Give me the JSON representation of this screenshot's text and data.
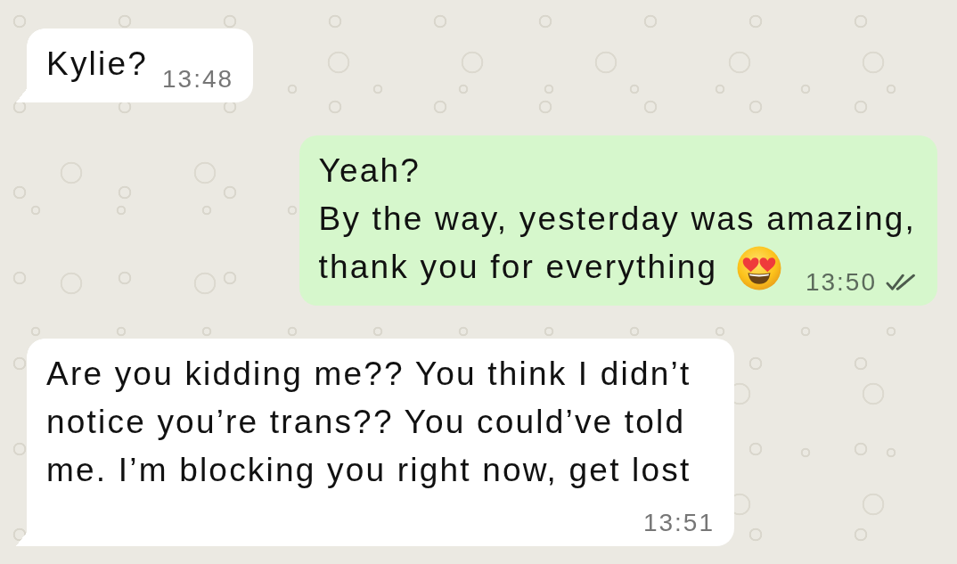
{
  "messages": [
    {
      "kind": "incoming",
      "tail": true,
      "lines": [
        "Kylie?"
      ],
      "emoji": false,
      "time": "13:48"
    },
    {
      "kind": "outgoing",
      "tail": false,
      "lines": [
        "Yeah?",
        "By the way, yesterday was amazing,",
        "thank you for everything"
      ],
      "emoji": true,
      "time": "13:50",
      "delivered": true,
      "read": false
    },
    {
      "kind": "incoming",
      "tail": true,
      "lines": [
        "Are you kidding me?? You think I didn’t",
        "notice you’re trans?? You could’ve told",
        "me. I’m blocking you right now, get lost"
      ],
      "emoji": false,
      "time": "13:51"
    }
  ]
}
